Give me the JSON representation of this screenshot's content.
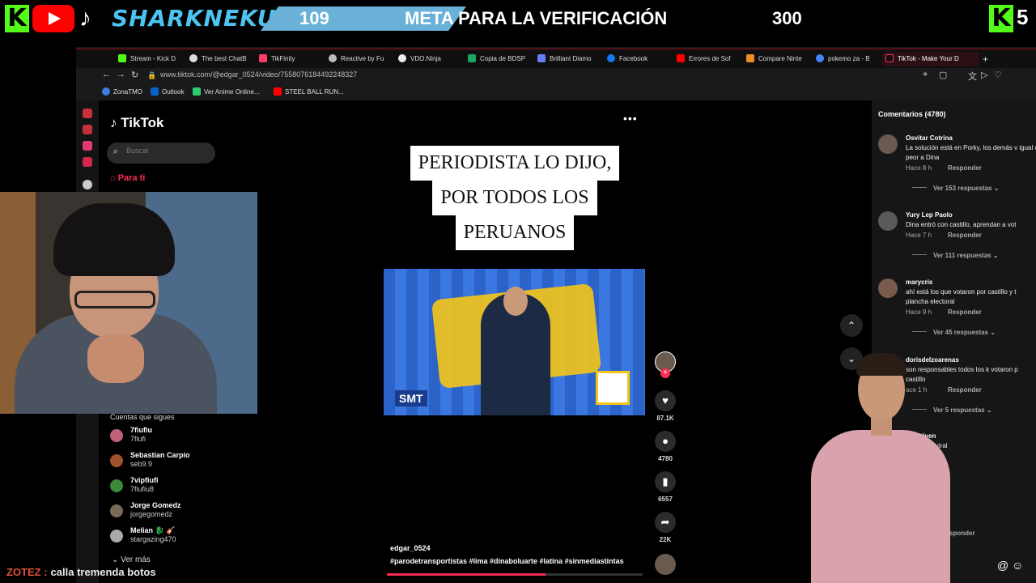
{
  "overlay": {
    "kick_letter": "K",
    "brand": "SHARKNEKU",
    "goal": {
      "current": "109",
      "title": "META PARA LA VERIFICACIÓN",
      "target": "300",
      "progress": 0.363
    },
    "right_letter": "K",
    "right_number": "5",
    "colors": {
      "kick": "#53fc18",
      "youtube": "#ff0000",
      "brand": "#4cc3f0",
      "goal_fill": "#6ab1d8"
    }
  },
  "browser": {
    "tabs": [
      {
        "label": "Stream - Kick D",
        "icon": "kick-icon"
      },
      {
        "label": "The best ChatB",
        "icon": "chat-icon"
      },
      {
        "label": "TikFinity",
        "icon": "tikfinity-icon"
      },
      {
        "label": "Reactive by Fu",
        "icon": "gear-icon"
      },
      {
        "label": "VDO.Ninja",
        "icon": "ninja-icon"
      },
      {
        "label": "Copia de BDSP",
        "icon": "sheets-icon"
      },
      {
        "label": "Brilliant Diamo",
        "icon": "pokemon-icon"
      },
      {
        "label": "Facebook",
        "icon": "facebook-icon"
      },
      {
        "label": "Errores de Sof",
        "icon": "youtube-icon"
      },
      {
        "label": "Compare Ninte",
        "icon": "compare-icon"
      },
      {
        "label": "pokemo za - B",
        "icon": "google-icon"
      },
      {
        "label": "TikTok - Make Your D",
        "icon": "tiktok-icon"
      }
    ],
    "url": "www.tiktok.com/@edgar_0524/video/7558076184492248327",
    "bookmarks": [
      {
        "label": "ZonaTMO",
        "icon": "zonatmo-icon"
      },
      {
        "label": "Outlook",
        "icon": "outlook-icon"
      },
      {
        "label": "Ver Anime Online...",
        "icon": "anime-icon"
      },
      {
        "label": "STEEL BALL RUN...",
        "icon": "youtube-icon"
      }
    ]
  },
  "tiktok": {
    "brand": "TikTok",
    "search_placeholder": "Buscar",
    "nav_foryou": "Para ti",
    "following_title": "Cuentas que sigues",
    "following": [
      {
        "name": "7fiufiu",
        "handle": "7fiufi"
      },
      {
        "name": "Sebastian Carpio",
        "handle": "seb9.9"
      },
      {
        "name": "7vipfiufi",
        "handle": "7fiufiu8"
      },
      {
        "name": "Jorge Gomedz",
        "handle": "jorgegomedz"
      },
      {
        "name": "Melian 🐉 🎸",
        "handle": "stargazing470"
      }
    ],
    "see_more": "Ver más",
    "more_dots": "•••",
    "caption_lines": [
      "PERIODISTA LO DIJO,",
      "POR TODOS LOS",
      "PERUANOS"
    ],
    "video_logo_text": "SMT",
    "actions": [
      {
        "icon": "heart-icon",
        "glyph": "♥",
        "count": "87.1K"
      },
      {
        "icon": "comment-icon",
        "glyph": "●",
        "count": "4780"
      },
      {
        "icon": "bookmark-icon",
        "glyph": "▮",
        "count": "6557"
      },
      {
        "icon": "share-icon",
        "glyph": "➦",
        "count": "22K"
      }
    ],
    "plus": "+",
    "author": "edgar_0524",
    "hashtags": "#parodetransportistas #lima #dinaboluarte #latina #sinmediastintas",
    "video_progress": 0.62,
    "arrow_up": "⌃",
    "arrow_down": "⌄"
  },
  "comments": {
    "title": "Comentarios (4780)",
    "items": [
      {
        "user": "Osvitar Cotrina",
        "text": "La solución está en Porky, los demás v igual o peor a Dina",
        "time": "Hace 8 h",
        "reply": "Responder",
        "replies": "Ver 153 respuestas ⌄"
      },
      {
        "user": "Yury Lep Paolo",
        "text": "Dina entró con castillo, aprendan a vot",
        "time": "Hace 7 h",
        "reply": "Responder",
        "replies": "Ver 111 respuestas ⌄"
      },
      {
        "user": "marycris",
        "text": "ahí está los que votaron por castillo y t plancha electoral",
        "time": "Hace 9 h",
        "reply": "Responder",
        "replies": "Ver 45 respuestas ⌄"
      },
      {
        "user": "dorisdelzoarenas",
        "text": "son responsables todos los k votaron p castillo",
        "time": "ace 1 h",
        "reply": "Responder",
        "replies": "Ver 5 respuestas ⌄"
      },
      {
        "user": "Ms Stiven",
        "text": "ngámoslo viral",
        "time": "",
        "reply": "",
        "replies": ""
      }
    ],
    "bottom_reply": "sponder",
    "input_icons": "@ ☺"
  },
  "chat": {
    "user": "ZOTEZ :",
    "message": "calla tremenda botos"
  }
}
